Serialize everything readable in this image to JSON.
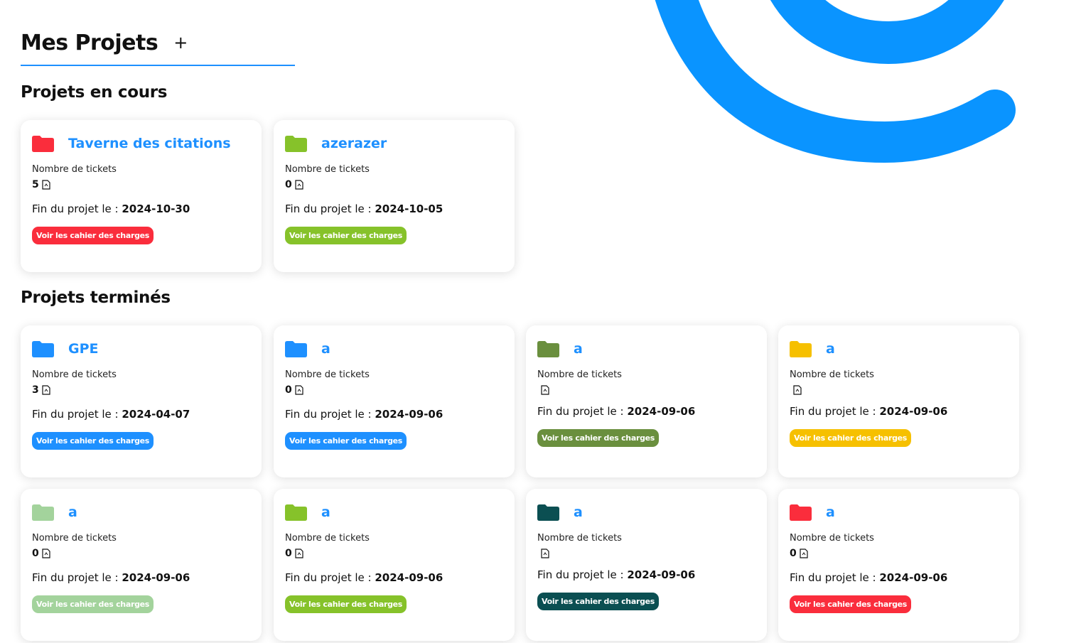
{
  "header": {
    "title": "Mes Projets",
    "add_label": "+"
  },
  "sections": {
    "ongoing": "Projets en cours",
    "done": "Projets terminés"
  },
  "labels": {
    "tickets": "Nombre de tickets",
    "end_prefix": "Fin du projet le : ",
    "charges_button": "Voir les cahier des charges"
  },
  "projects_ongoing": [
    {
      "name": "Taverne des citations",
      "tickets": "5",
      "end_date": "2024-10-30",
      "color": "#fa2d3c"
    },
    {
      "name": "azerazer",
      "tickets": "0",
      "end_date": "2024-10-05",
      "color": "#86c22a"
    }
  ],
  "projects_done": [
    {
      "name": "GPE",
      "tickets": "3",
      "end_date": "2024-04-07",
      "color": "#1e90ff"
    },
    {
      "name": "a",
      "tickets": "0",
      "end_date": "2024-09-06",
      "color": "#1e90ff"
    },
    {
      "name": "a",
      "tickets": "",
      "end_date": "2024-09-06",
      "color": "#6a8f3e"
    },
    {
      "name": "a",
      "tickets": "",
      "end_date": "2024-09-06",
      "color": "#f6c000"
    },
    {
      "name": "a",
      "tickets": "0",
      "end_date": "2024-09-06",
      "color": "#a3d39c"
    },
    {
      "name": "a",
      "tickets": "0",
      "end_date": "2024-09-06",
      "color": "#86c22a"
    },
    {
      "name": "a",
      "tickets": "",
      "end_date": "2024-09-06",
      "color": "#0b4f52"
    },
    {
      "name": "a",
      "tickets": "0",
      "end_date": "2024-09-06",
      "color": "#fa2d3c"
    }
  ],
  "colors": {
    "accent": "#1e90ff",
    "deco": "#0a94ff"
  },
  "icons": {
    "folder": "folder-icon",
    "ticket": "file-ticket-icon",
    "add": "plus-icon"
  }
}
